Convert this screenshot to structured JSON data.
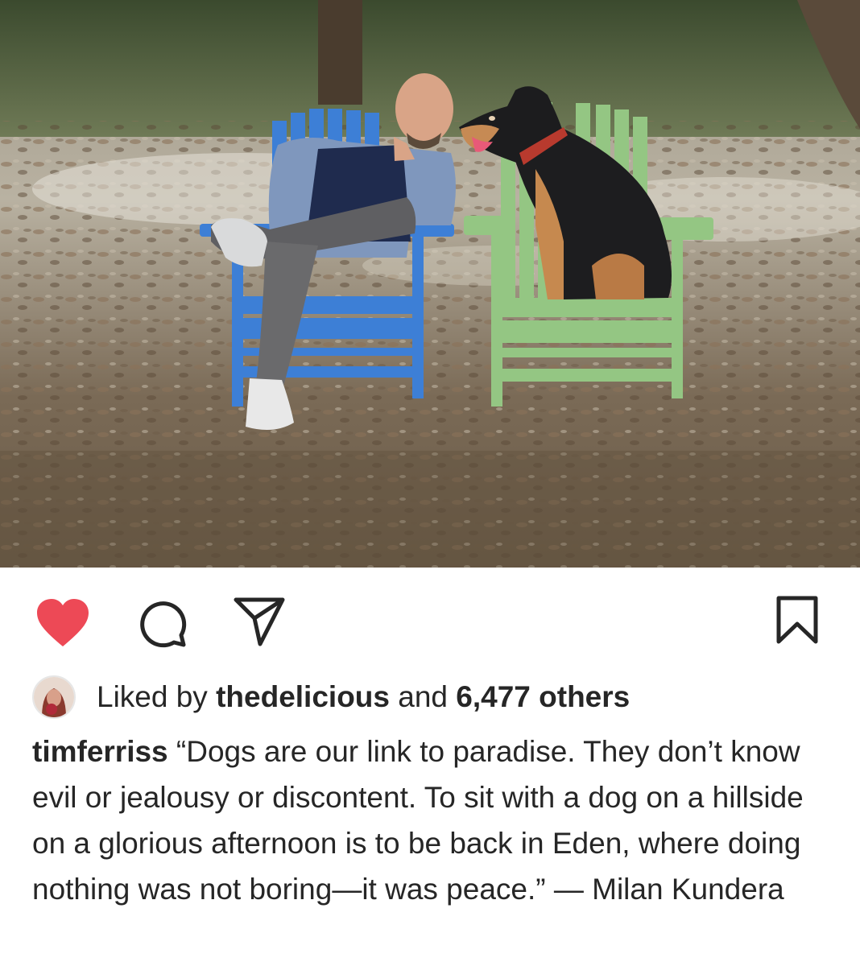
{
  "post": {
    "image_alt": "Man and dog sitting in blue and green Adirondack chairs in a wooded clearing",
    "colors": {
      "like_active": "#ed4956",
      "text": "#262626"
    }
  },
  "actions": {
    "like_icon": "heart-filled-icon",
    "comment_icon": "comment-icon",
    "share_icon": "paper-plane-icon",
    "save_icon": "bookmark-icon"
  },
  "likes": {
    "prefix": "Liked by",
    "user": "thedelicious",
    "and": "and",
    "count": "6,477 others"
  },
  "caption": {
    "username": "timferriss",
    "text": "“Dogs are our link to paradise. They don’t know evil or jealousy or discontent. To sit with a dog on a hillside on a glorious afternoon is to be back in Eden, where doing nothing was not boring—it was peace.” — Milan Kundera"
  }
}
